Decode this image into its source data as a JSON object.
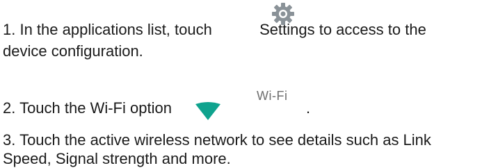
{
  "steps": {
    "step1_part_a": "1. In the applications list, touch",
    "step1_part_b": "Settings to access to the",
    "step1_line2": "device configuration.",
    "step2_text": "2. Touch the Wi-Fi option",
    "step2_wifi_label": "Wi-Fi",
    "step2_period": ".",
    "step3_line1": "3. Touch the active wireless network to see details such as Link",
    "step3_line2": "Speed, Signal strength and more."
  },
  "icons": {
    "settings": "gear-icon",
    "wifi": "wifi-icon"
  },
  "colors": {
    "text": "#1a1a1a",
    "gear": "#8a9298",
    "wifi": "#0fa38e",
    "wifi_label": "#6e6e6e"
  }
}
